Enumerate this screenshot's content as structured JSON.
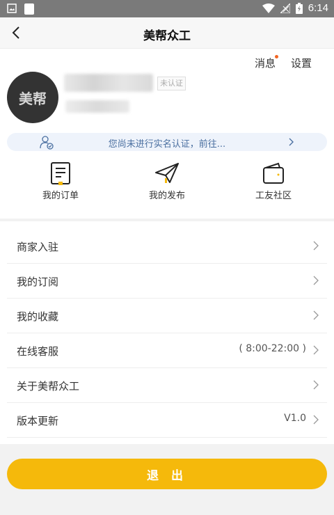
{
  "status_bar": {
    "time": "6:14"
  },
  "nav": {
    "title": "美帮众工"
  },
  "profile": {
    "messages_label": "消息",
    "settings_label": "设置",
    "avatar_text": "美帮",
    "verify_badge": "未认证",
    "verify_banner": "您尚未进行实名认证，前往..."
  },
  "quick_actions": [
    {
      "label": "我的订单",
      "icon": "order-doc-icon"
    },
    {
      "label": "我的发布",
      "icon": "paper-plane-icon"
    },
    {
      "label": "工友社区",
      "icon": "wallet-icon"
    }
  ],
  "menu": [
    {
      "label": "商家入驻",
      "value": ""
    },
    {
      "label": "我的订阅",
      "value": ""
    },
    {
      "label": "我的收藏",
      "value": ""
    },
    {
      "label": "在线客服",
      "value": "( 8:00-22:00 )"
    },
    {
      "label": "关于美帮众工",
      "value": ""
    },
    {
      "label": "版本更新",
      "value": "V1.0"
    }
  ],
  "logout_label": "退 出",
  "colors": {
    "accent": "#f5b90b",
    "notify_dot": "#f26522",
    "link_blue": "#4a6fa0"
  }
}
